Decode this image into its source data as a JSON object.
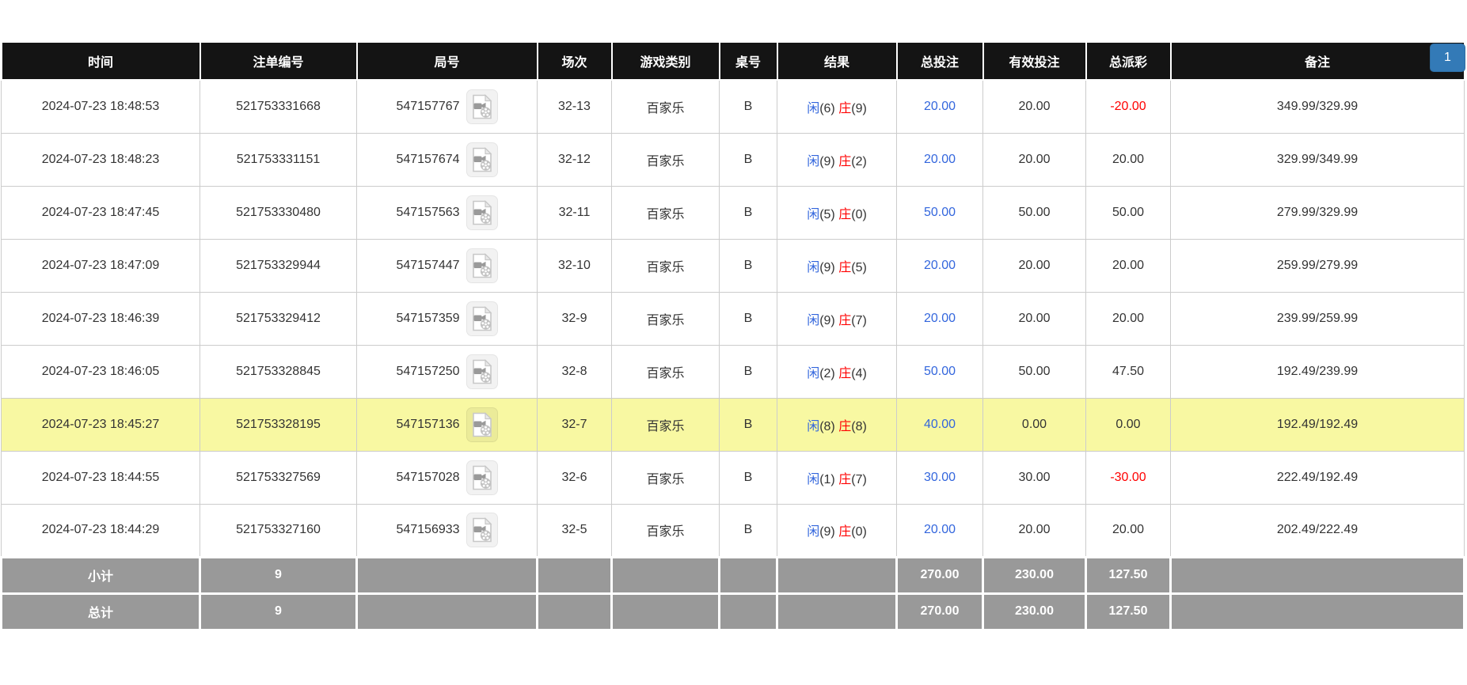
{
  "pagination": {
    "current_page": "1"
  },
  "colors": {
    "header_bg": "#141414",
    "summary_bg": "#999999",
    "highlight_row_bg": "#f8f8a2",
    "link_blue": "#3366dd",
    "negative_red": "#ff0000",
    "page_button_blue": "#337ab7"
  },
  "table": {
    "columns": [
      {
        "label": "时间"
      },
      {
        "label": "注单编号"
      },
      {
        "label": "局号"
      },
      {
        "label": "场次"
      },
      {
        "label": "游戏类别"
      },
      {
        "label": "桌号"
      },
      {
        "label": "结果"
      },
      {
        "label": "总投注"
      },
      {
        "label": "有效投注"
      },
      {
        "label": "总派彩"
      },
      {
        "label": "备注"
      }
    ],
    "rows": [
      {
        "time": "2024-07-23 18:48:53",
        "bet_id": "521753331668",
        "round_id": "547157767",
        "session": "32-13",
        "game": "百家乐",
        "table_no": "B",
        "result_player": "闲",
        "result_player_num": "(6)",
        "result_banker": "庄",
        "result_banker_num": "(9)",
        "total_bet": "20.00",
        "valid_bet": "20.00",
        "payout": "-20.00",
        "remark": "349.99/329.99",
        "highlighted": false
      },
      {
        "time": "2024-07-23 18:48:23",
        "bet_id": "521753331151",
        "round_id": "547157674",
        "session": "32-12",
        "game": "百家乐",
        "table_no": "B",
        "result_player": "闲",
        "result_player_num": "(9)",
        "result_banker": "庄",
        "result_banker_num": "(2)",
        "total_bet": "20.00",
        "valid_bet": "20.00",
        "payout": "20.00",
        "remark": "329.99/349.99",
        "highlighted": false
      },
      {
        "time": "2024-07-23 18:47:45",
        "bet_id": "521753330480",
        "round_id": "547157563",
        "session": "32-11",
        "game": "百家乐",
        "table_no": "B",
        "result_player": "闲",
        "result_player_num": "(5)",
        "result_banker": "庄",
        "result_banker_num": "(0)",
        "total_bet": "50.00",
        "valid_bet": "50.00",
        "payout": "50.00",
        "remark": "279.99/329.99",
        "highlighted": false
      },
      {
        "time": "2024-07-23 18:47:09",
        "bet_id": "521753329944",
        "round_id": "547157447",
        "session": "32-10",
        "game": "百家乐",
        "table_no": "B",
        "result_player": "闲",
        "result_player_num": "(9)",
        "result_banker": "庄",
        "result_banker_num": "(5)",
        "total_bet": "20.00",
        "valid_bet": "20.00",
        "payout": "20.00",
        "remark": "259.99/279.99",
        "highlighted": false
      },
      {
        "time": "2024-07-23 18:46:39",
        "bet_id": "521753329412",
        "round_id": "547157359",
        "session": "32-9",
        "game": "百家乐",
        "table_no": "B",
        "result_player": "闲",
        "result_player_num": "(9)",
        "result_banker": "庄",
        "result_banker_num": "(7)",
        "total_bet": "20.00",
        "valid_bet": "20.00",
        "payout": "20.00",
        "remark": "239.99/259.99",
        "highlighted": false
      },
      {
        "time": "2024-07-23 18:46:05",
        "bet_id": "521753328845",
        "round_id": "547157250",
        "session": "32-8",
        "game": "百家乐",
        "table_no": "B",
        "result_player": "闲",
        "result_player_num": "(2)",
        "result_banker": "庄",
        "result_banker_num": "(4)",
        "total_bet": "50.00",
        "valid_bet": "50.00",
        "payout": "47.50",
        "remark": "192.49/239.99",
        "highlighted": false
      },
      {
        "time": "2024-07-23 18:45:27",
        "bet_id": "521753328195",
        "round_id": "547157136",
        "session": "32-7",
        "game": "百家乐",
        "table_no": "B",
        "result_player": "闲",
        "result_player_num": "(8)",
        "result_banker": "庄",
        "result_banker_num": "(8)",
        "total_bet": "40.00",
        "valid_bet": "0.00",
        "payout": "0.00",
        "remark": "192.49/192.49",
        "highlighted": true
      },
      {
        "time": "2024-07-23 18:44:55",
        "bet_id": "521753327569",
        "round_id": "547157028",
        "session": "32-6",
        "game": "百家乐",
        "table_no": "B",
        "result_player": "闲",
        "result_player_num": "(1)",
        "result_banker": "庄",
        "result_banker_num": "(7)",
        "total_bet": "30.00",
        "valid_bet": "30.00",
        "payout": "-30.00",
        "remark": "222.49/192.49",
        "highlighted": false
      },
      {
        "time": "2024-07-23 18:44:29",
        "bet_id": "521753327160",
        "round_id": "547156933",
        "session": "32-5",
        "game": "百家乐",
        "table_no": "B",
        "result_player": "闲",
        "result_player_num": "(9)",
        "result_banker": "庄",
        "result_banker_num": "(0)",
        "total_bet": "20.00",
        "valid_bet": "20.00",
        "payout": "20.00",
        "remark": "202.49/222.49",
        "highlighted": false
      }
    ],
    "subtotal": {
      "label": "小计",
      "count": "9",
      "total_bet": "270.00",
      "valid_bet": "230.00",
      "payout": "127.50"
    },
    "total": {
      "label": "总计",
      "count": "9",
      "total_bet": "270.00",
      "valid_bet": "230.00",
      "payout": "127.50"
    }
  }
}
